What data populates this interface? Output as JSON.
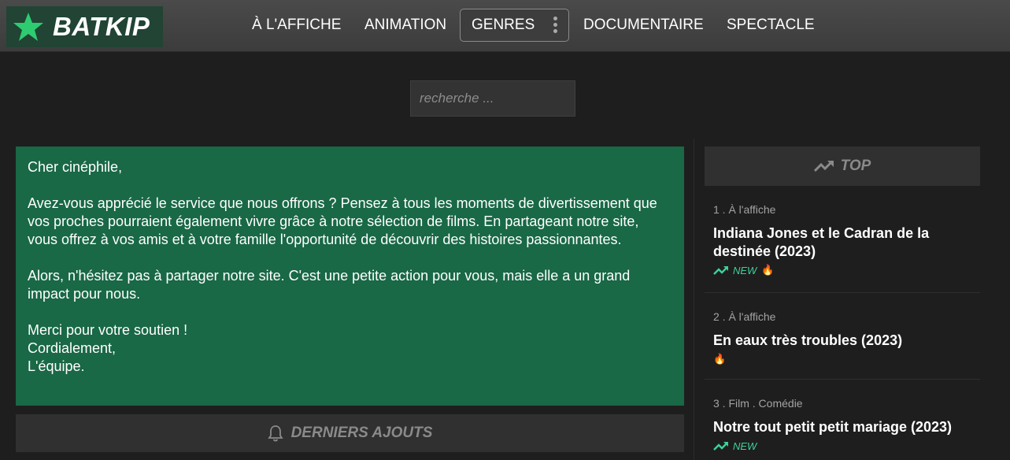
{
  "brand": {
    "name": "BATKIP",
    "icon": "star-icon",
    "color": "#2ecc71"
  },
  "nav": {
    "items": [
      "À L'AFFICHE",
      "ANIMATION",
      "GENRES",
      "DOCUMENTAIRE",
      "SPECTACLE"
    ]
  },
  "search": {
    "placeholder": "recherche ...",
    "value": ""
  },
  "message": {
    "greeting": "Cher cinéphile,",
    "paragraph1": "Avez-vous apprécié le service que nous offrons ? Pensez à tous les moments de divertissement que vos proches pourraient également vivre grâce à notre sélection de films. En partageant notre site, vous offrez à vos amis et à votre famille l'opportunité de découvrir des histoires passionnantes.",
    "paragraph2": "Alors, n'hésitez pas à partager notre site. C'est une petite action pour vous, mais elle a un grand impact pour nous.",
    "closing1": "Merci pour votre soutien !",
    "closing2": "Cordialement,",
    "closing3": "L'équipe.",
    "background": "#196846"
  },
  "latest": {
    "label": "DERNIERS AJOUTS",
    "icon": "bell-icon"
  },
  "top": {
    "label": "TOP",
    "icon": "trending-up-icon",
    "items": [
      {
        "meta": "1 . À l'affiche",
        "title": "Indiana Jones et le Cadran de la destinée (2023)",
        "new_label": "NEW",
        "fire": "🔥"
      },
      {
        "meta": "2 . À l'affiche",
        "title": "En eaux très troubles (2023)",
        "fire": "🔥"
      },
      {
        "meta": "3 . Film . Comédie",
        "title": "Notre tout petit petit mariage (2023)",
        "new_label": "NEW"
      }
    ]
  },
  "colors": {
    "accent": "#3ed09a",
    "topbar": "#444444",
    "page_bg": "#1e1e1e"
  }
}
